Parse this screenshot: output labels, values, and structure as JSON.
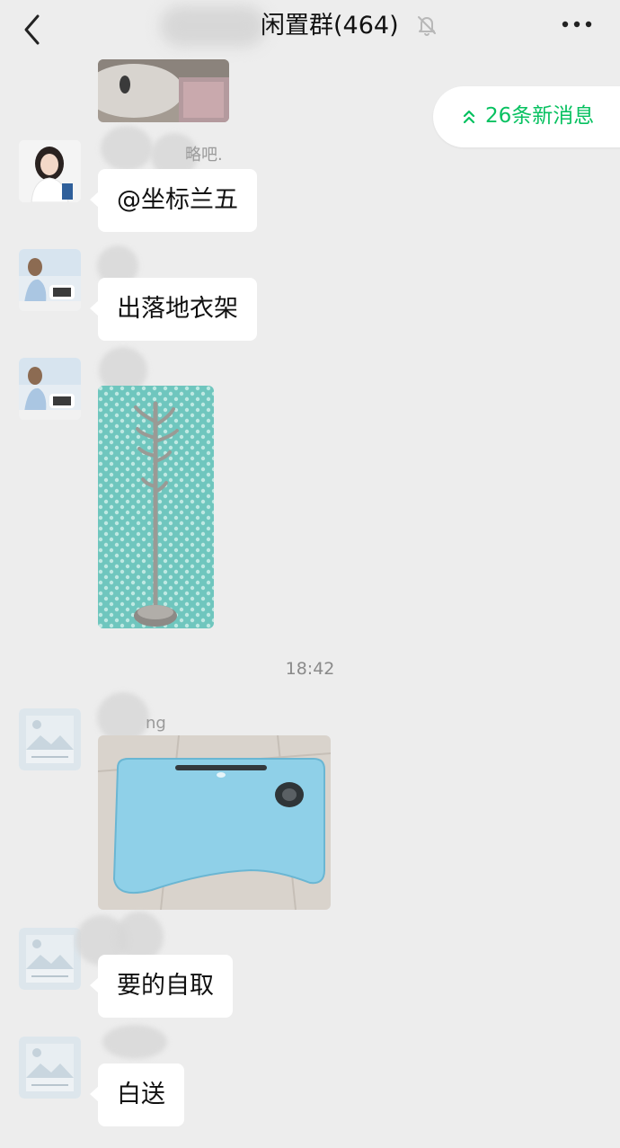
{
  "header": {
    "title": "闲置群(464)"
  },
  "new_messages": {
    "label": "26条新消息",
    "accent": "#07c160"
  },
  "messages": [
    {
      "nickname": "略吧.",
      "text": "@坐标兰五"
    },
    {
      "nickname": "",
      "text": "出落地衣架"
    },
    {
      "nickname": "",
      "image": "coat-rack-photo"
    },
    {
      "timestamp": "18:42"
    },
    {
      "nickname": "ng",
      "image": "lap-desk-photo"
    },
    {
      "nickname": "",
      "text": "要的自取"
    },
    {
      "nickname": "",
      "text": "白送"
    }
  ],
  "icons": {
    "back": "chevron-left-icon",
    "mute": "bell-off-icon",
    "more": "more-dots-icon",
    "new_messages": "double-chevron-up-icon"
  }
}
